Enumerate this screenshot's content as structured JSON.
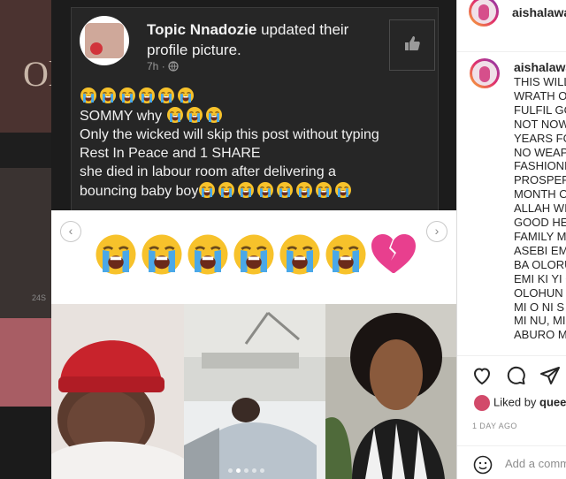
{
  "fb_post": {
    "author": "Topic Nnadozie",
    "action": "updated their profile picture.",
    "time": "7h",
    "crying_row_count": 6,
    "lines": [
      "SOMMY why",
      "Only the wicked will skip this post without typing",
      "Rest In Peace and 1 SHARE",
      "she died in labour room after delivering a",
      "bouncing baby boy"
    ]
  },
  "carousel": {
    "prev_label": "‹",
    "next_label": "›",
    "slide_count": 5,
    "active_slide": 1
  },
  "background": {
    "left_letter": "Ol",
    "left_small": "24S"
  },
  "instagram": {
    "username": "aishalawa",
    "caption_username": "aishalawa",
    "caption_lines": [
      "THIS WILL",
      "WRATH O",
      "FULFIL GO",
      "NOT NOW",
      "YEARS FO",
      "NO WEAP",
      "FASHIONE",
      "PROSPER,",
      "MONTH O",
      "ALLAH WI",
      "GOOD HE",
      "FAMILY M",
      "ASEBI EMU",
      "BA OLORU",
      "EMI KI YI C",
      "OLOHUN",
      "MI O NI S",
      "MI NU, MI",
      "ABURO M"
    ],
    "liked_by_prefix": "Liked by",
    "liked_by_user": "quee",
    "time_ago": "1 DAY AGO",
    "comment_placeholder": "Add a comm"
  },
  "colors": {
    "fb_background": "#1c1c1c",
    "ig_text": "#262626",
    "ig_meta": "#8e8e8e"
  }
}
